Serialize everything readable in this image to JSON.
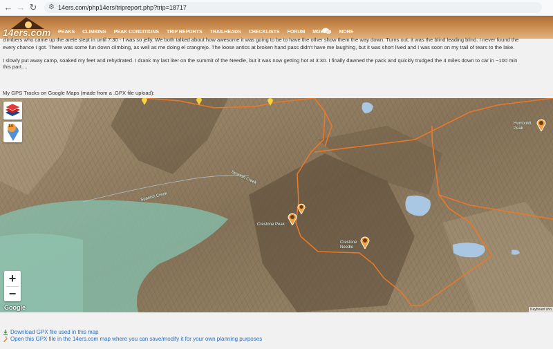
{
  "browser": {
    "url": "14ers.com/php14ers/tripreport.php?trip=18717"
  },
  "site": {
    "logo_text": "14ers.com",
    "menu": [
      "PEAKS",
      "CLIMBING",
      "PEAK CONDITIONS",
      "TRIP REPORTS",
      "TRAILHEADS",
      "CHECKLISTS",
      "FORUM",
      "MOBILE",
      "MORE"
    ]
  },
  "report": {
    "line1": "climbers who came up the arete slept in until 7:30 - I was so jelly. We both talked about how awesome it was going to be to have the other show them the way down. Turns out, it was the blind leading blind. I never found the",
    "line2": "every chance I got. There was some fun down climbing, as well as me doing el crangrejo. The loose antics at broken hand pass didn't have me laughing, but it was short lived and I was soon on my trail of tears to the lake.",
    "line3": "I slowly put away camp, soaked my feet and rehydrated. I drank my last liter on the summit of the Needle, but it was now getting hot at 3:30. I finally dawned the pack and quickly trudged the 4 miles down to car in ~100 min",
    "line4": "this part....",
    "gps_heading": "My GPS Tracks on Google Maps (made from a .GPX file upload):"
  },
  "map": {
    "labels": {
      "spanish_creek": "Spanish Creek",
      "spanish_creek2": "Spanish Creek",
      "crestone_peak": "Crestone Peak",
      "crestone_needle": "Crestone Needle",
      "humboldt_peak": "Humboldt Peak",
      "pin_badge": "14"
    },
    "zoom_in": "+",
    "zoom_out": "−",
    "google": "Google",
    "attribution": "Keyboard sho",
    "colors": {
      "track": "#e8792a",
      "water": "#a9c6e2",
      "forest": "#7fbfad"
    }
  },
  "links": {
    "download": "Download GPX file used in this map",
    "open": "Open this GPX file in the 14ers.com map where you can save/modify it for your own planning purposes"
  }
}
